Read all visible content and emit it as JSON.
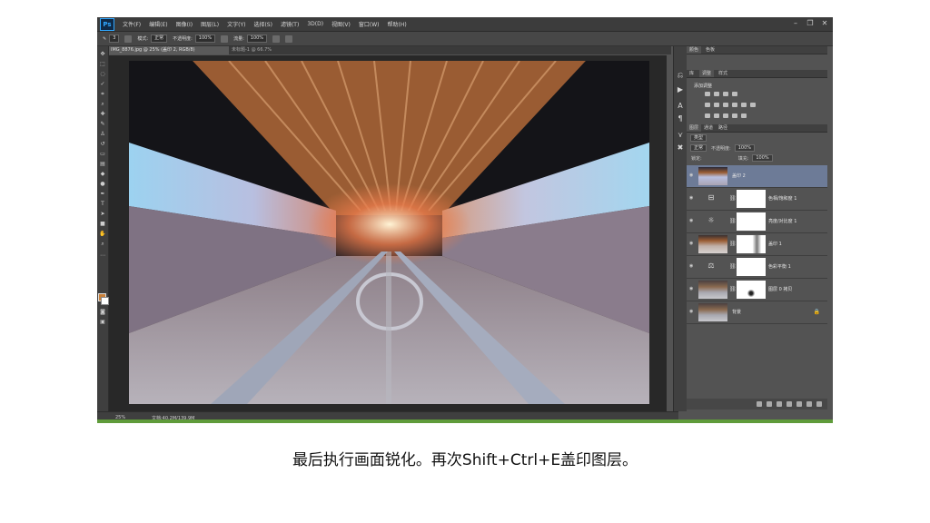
{
  "app": {
    "logo": "Ps",
    "menu": [
      "文件(F)",
      "编辑(E)",
      "图像(I)",
      "图层(L)",
      "文字(Y)",
      "选择(S)",
      "滤镜(T)",
      "3D(D)",
      "视图(V)",
      "窗口(W)",
      "帮助(H)"
    ],
    "window_buttons": [
      "–",
      "❐",
      "✕"
    ]
  },
  "options": {
    "size": "3",
    "mode_label": "模式:",
    "mode_value": "正常",
    "opacity_label": "不透明度:",
    "opacity_value": "100%",
    "flow_label": "流量:",
    "flow_value": "100%"
  },
  "document": {
    "tab_title": "IMG_8876.jpg @ 25% (盖印 2, RGB/8)",
    "tab2_title": "未标题-1 @ 66.7%",
    "zoom": "25%",
    "doc_info": "文档:40.2M/139.9M"
  },
  "colors": {
    "foreground": "#c8803a",
    "background": "#ffffff",
    "selected_layer": "#6d7b97",
    "status_green": "#5f9b3a"
  },
  "panels": {
    "top_tabs": [
      "颜色",
      "色板"
    ],
    "adj_tabs": [
      "库",
      "调整",
      "样式"
    ],
    "adjustments_title": "添加调整",
    "layer_tabs": [
      "图层",
      "通道",
      "路径"
    ],
    "kind_filter": "类型",
    "blend_mode": "正常",
    "opacity_label": "不透明度:",
    "opacity_value": "100%",
    "lock_label": "锁定:",
    "fill_label": "填充:",
    "fill_value": "100%"
  },
  "layers": [
    {
      "name": "盖印 2",
      "kind": "photo",
      "selected": true,
      "has_mask": false
    },
    {
      "name": "色相/饱和度 1",
      "kind": "adjust",
      "glyph": "⊟",
      "selected": false,
      "has_mask": true
    },
    {
      "name": "亮度/对比度 1",
      "kind": "adjust",
      "glyph": "☼",
      "selected": false,
      "has_mask": true
    },
    {
      "name": "盖印 1",
      "kind": "photo",
      "selected": false,
      "has_mask": true
    },
    {
      "name": "色彩平衡 1",
      "kind": "adjust",
      "glyph": "⚖",
      "selected": false,
      "has_mask": true
    },
    {
      "name": "图层 0 拷贝",
      "kind": "photo",
      "selected": false,
      "has_mask": true
    },
    {
      "name": "背景",
      "kind": "photo",
      "selected": false,
      "has_mask": false,
      "locked": true
    }
  ],
  "caption": "最后执行画面锐化。再次Shift+Ctrl+E盖印图层。"
}
